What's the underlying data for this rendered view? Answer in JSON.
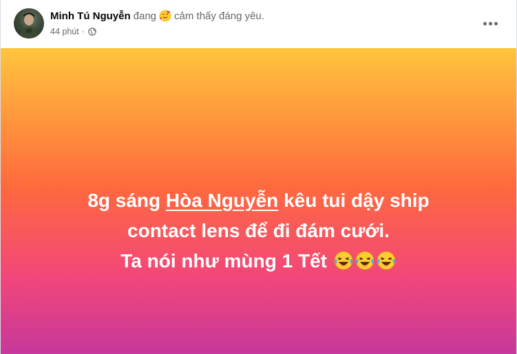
{
  "post": {
    "author": "Minh Tú Nguyễn",
    "feeling_prefix": "đang",
    "feeling_icon": "grinning-hearts-emoji",
    "feeling_text": "cảm thấy đáng yêu.",
    "time": "44 phút",
    "separator": "·",
    "privacy_icon": "globe-icon",
    "more_icon": "more-options-icon",
    "background": {
      "gradient": [
        "#ffc53d",
        "#ff6a3d",
        "#f2467a",
        "#c6389b"
      ]
    },
    "text": {
      "line1_before": "8g sáng",
      "mention": "Hòa Nguyễn",
      "line1_after": "kêu tui dậy ship",
      "line2": "contact lens để đi đám cưới.",
      "line3": "Ta nói như mùng 1 Tết",
      "emojis": [
        "laughing-tears-emoji",
        "laughing-tears-emoji",
        "laughing-tears-emoji"
      ]
    }
  }
}
